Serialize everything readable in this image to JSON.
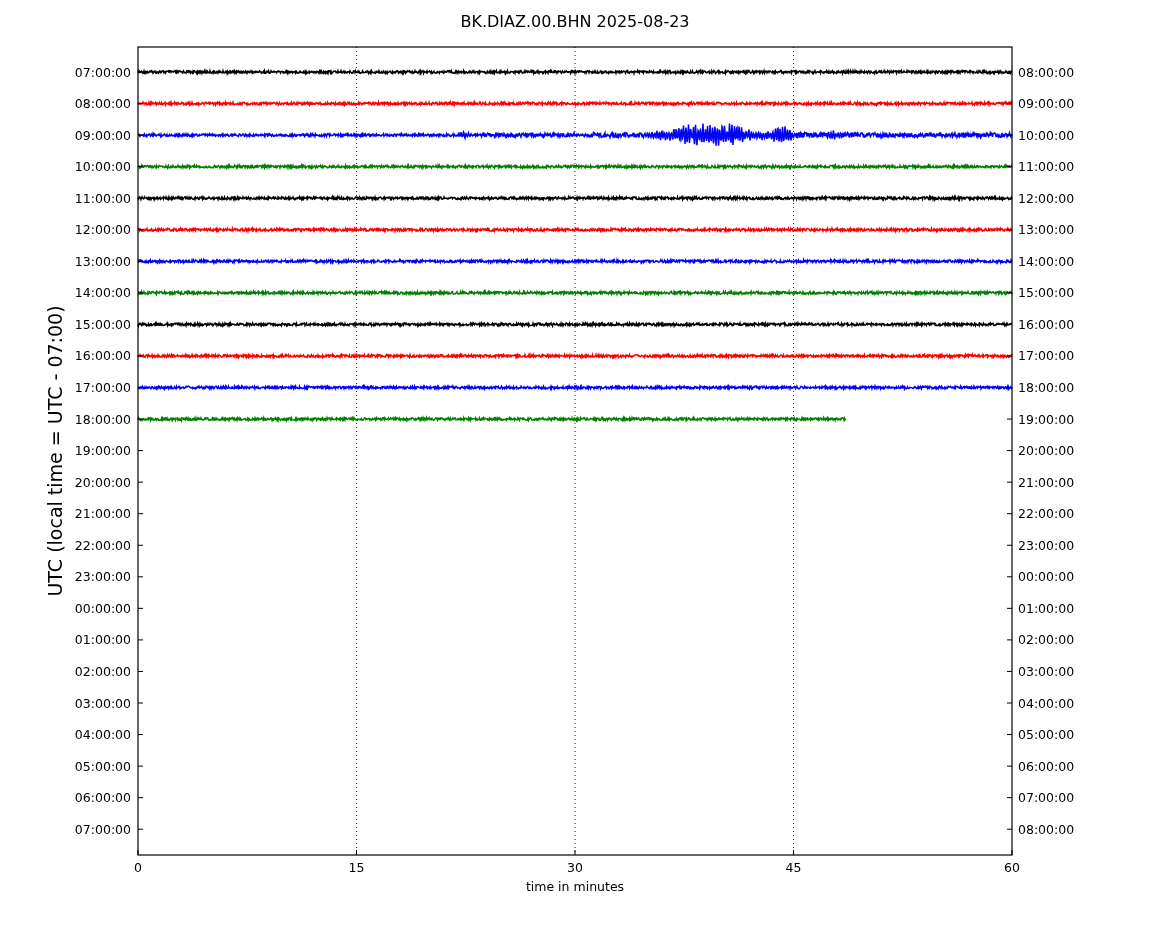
{
  "title": "BK.DIAZ.00.BHN 2025-08-23",
  "plot": {
    "ylabel": "UTC (local time = UTC - 07:00)",
    "xlabel": "time in minutes",
    "xticks": [
      "0",
      "15",
      "30",
      "45",
      "60"
    ],
    "rows": [
      {
        "left": "07:00:00",
        "right": "08:00:00"
      },
      {
        "left": "08:00:00",
        "right": "09:00:00"
      },
      {
        "left": "09:00:00",
        "right": "10:00:00"
      },
      {
        "left": "10:00:00",
        "right": "11:00:00"
      },
      {
        "left": "11:00:00",
        "right": "12:00:00"
      },
      {
        "left": "12:00:00",
        "right": "13:00:00"
      },
      {
        "left": "13:00:00",
        "right": "14:00:00"
      },
      {
        "left": "14:00:00",
        "right": "15:00:00"
      },
      {
        "left": "15:00:00",
        "right": "16:00:00"
      },
      {
        "left": "16:00:00",
        "right": "17:00:00"
      },
      {
        "left": "17:00:00",
        "right": "18:00:00"
      },
      {
        "left": "18:00:00",
        "right": "19:00:00"
      },
      {
        "left": "19:00:00",
        "right": "20:00:00"
      },
      {
        "left": "20:00:00",
        "right": "21:00:00"
      },
      {
        "left": "21:00:00",
        "right": "22:00:00"
      },
      {
        "left": "22:00:00",
        "right": "23:00:00"
      },
      {
        "left": "23:00:00",
        "right": "00:00:00"
      },
      {
        "left": "00:00:00",
        "right": "01:00:00"
      },
      {
        "left": "01:00:00",
        "right": "02:00:00"
      },
      {
        "left": "02:00:00",
        "right": "03:00:00"
      },
      {
        "left": "03:00:00",
        "right": "04:00:00"
      },
      {
        "left": "04:00:00",
        "right": "05:00:00"
      },
      {
        "left": "05:00:00",
        "right": "06:00:00"
      },
      {
        "left": "06:00:00",
        "right": "07:00:00"
      },
      {
        "left": "07:00:00",
        "right": "08:00:00"
      }
    ],
    "traces": [
      {
        "color": "#000000",
        "kind": "quiet",
        "level": 1
      },
      {
        "color": "#ff0000",
        "kind": "quiet",
        "level": 1
      },
      {
        "color": "#0000ff",
        "kind": "event",
        "level": 1
      },
      {
        "color": "#008000",
        "kind": "quiet",
        "level": 1
      },
      {
        "color": "#000000",
        "kind": "quiet",
        "level": 1
      },
      {
        "color": "#ff0000",
        "kind": "quiet",
        "level": 1
      },
      {
        "color": "#0000ff",
        "kind": "quiet",
        "level": 1
      },
      {
        "color": "#008000",
        "kind": "quiet",
        "level": 1
      },
      {
        "color": "#000000",
        "kind": "quiet",
        "level": 1
      },
      {
        "color": "#ff0000",
        "kind": "quiet",
        "level": 1
      },
      {
        "color": "#0000ff",
        "kind": "quiet",
        "level": 1
      },
      {
        "color": "#008000",
        "kind": "quiet",
        "level": 0.81
      }
    ]
  }
}
